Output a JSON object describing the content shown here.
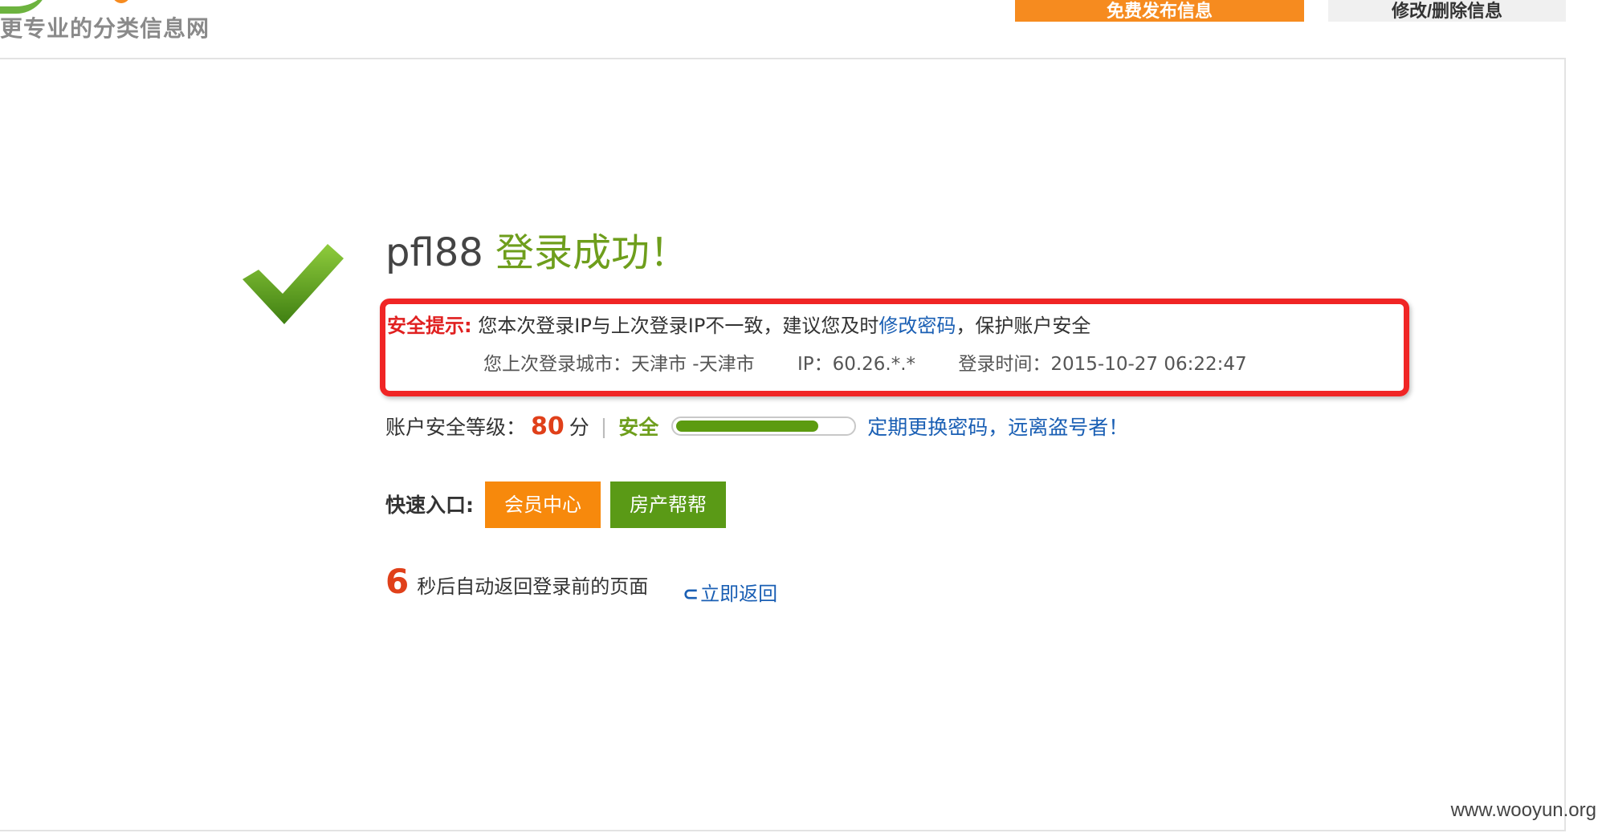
{
  "header": {
    "slogan": "更专业的分类信息网",
    "post_button": "免费发布信息",
    "manage_button": "修改/删除信息"
  },
  "result": {
    "username": "pfl88",
    "status": "登录成功！"
  },
  "warning": {
    "label": "安全提示:",
    "message_before": "您本次登录IP与上次登录IP不一致，建议您及时",
    "change_password_link": "修改密码",
    "message_after": "，保护账户安全",
    "last_city": "您上次登录城市：天津市 -天津市",
    "last_ip": "IP：60.26.*.*",
    "last_time": "登录时间：2015-10-27 06:22:47"
  },
  "security_level": {
    "label": "账户安全等级：",
    "score": "80",
    "unit": "分",
    "separator": "|",
    "rating": "安全",
    "progress": 0.8,
    "tip": "定期更换密码，远离盗号者！"
  },
  "quick_entry": {
    "label": "快速入口:",
    "member_center": "会员中心",
    "house_help": "房产帮帮"
  },
  "redirect": {
    "seconds": "6",
    "text": "秒后自动返回登录前的页面",
    "back_link": "立即返回"
  },
  "watermark": "www.wooyun.org",
  "colors": {
    "accent_orange": "#f68b1f",
    "accent_green": "#6e9e1c",
    "warning_red": "#f02525",
    "link_blue": "#1a5fb4"
  },
  "icons": {
    "success": "checkmark-icon",
    "back": "return-arrow-icon"
  }
}
